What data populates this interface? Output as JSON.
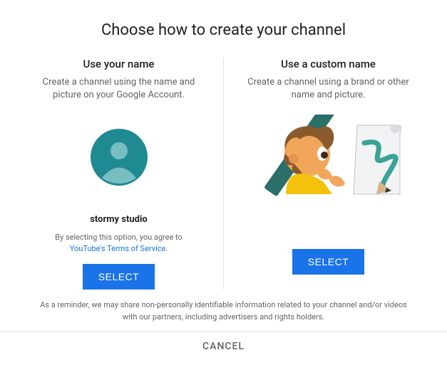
{
  "title": "Choose how to create your channel",
  "options": {
    "use_name": {
      "heading": "Use your name",
      "desc": "Create a channel using the name and picture on your Google Account.",
      "user_name": "stormy studio",
      "agree_prefix": "By selecting this option, you agree to",
      "agree_link": "YouTube's Terms of Service",
      "select_label": "SELECT"
    },
    "custom_name": {
      "heading": "Use a custom name",
      "desc": "Create a channel using a brand or other name and picture.",
      "select_label": "SELECT"
    }
  },
  "footer_note": "As a reminder, we may share non-personally identifiable information related to your channel and/or videos with our partners, including advertisers and rights holders.",
  "cancel_label": "CANCEL"
}
